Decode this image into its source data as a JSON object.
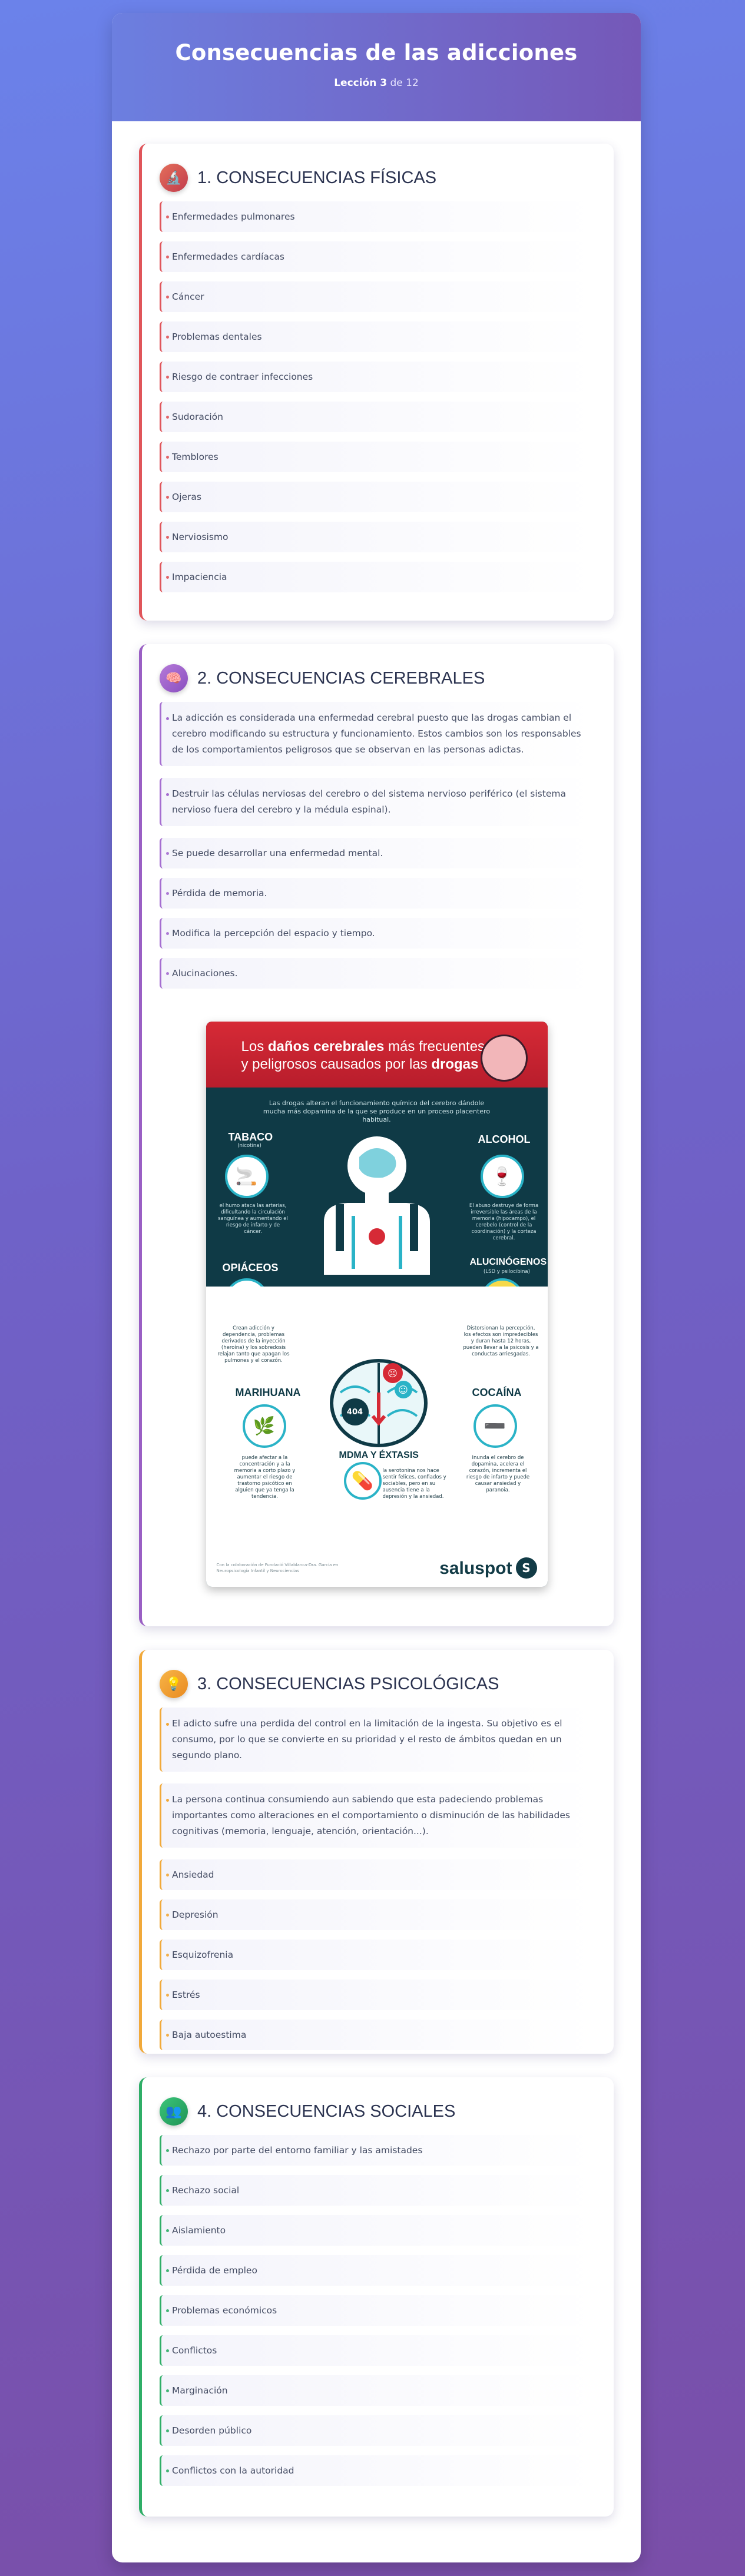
{
  "header": {
    "title": "Consecuencias de las adicciones",
    "lesson_label": "Lección 3",
    "lesson_of": "de 12"
  },
  "sections": [
    {
      "icon": "microscope-icon",
      "title": "1. CONSECUENCIAS FÍSICAS",
      "items": [
        "Enfermedades pulmonares",
        "Enfermedades cardíacas",
        "Cáncer",
        "Problemas dentales",
        "Riesgo de contraer infecciones",
        "Sudoración",
        "Temblores",
        "Ojeras",
        "Nerviosismo",
        "Impaciencia"
      ]
    },
    {
      "icon": "brain-icon",
      "title": "2. CONSECUENCIAS CEREBRALES",
      "paragraphs": [
        "La adicción es considerada una enfermedad cerebral puesto que las drogas cambian el cerebro modificando su estructura y funcionamiento. Estos cambios son los responsables de los comportamientos peligrosos que se observan en las personas adictas.",
        "Destruir las células nerviosas del cerebro o del sistema nervioso periférico (el sistema nervioso fuera del cerebro y la médula espinal)."
      ],
      "items": [
        "Se puede desarrollar una enfermedad mental.",
        "Pérdida de memoria.",
        "Modifica la percepción del espacio y tiempo.",
        "Alucinaciones."
      ]
    },
    {
      "icon": "lightbulb-icon",
      "title": "3. CONSECUENCIAS PSICOLÓGICAS",
      "paragraphs": [
        "El adicto sufre una perdida del control en la limitación de la ingesta. Su objetivo es el consumo, por lo que se convierte en su prioridad y el resto de ámbitos quedan en un segundo plano.",
        "La persona continua consumiendo aun sabiendo que esta padeciendo problemas importantes como alteraciones en el comportamiento o disminución de las habilidades cognitivas (memoria, lenguaje, atención, orientación...)."
      ],
      "items": [
        "Ansiedad",
        "Depresión",
        "Esquizofrenia",
        "Estrés",
        "Baja autoestima"
      ]
    },
    {
      "icon": "people-icon",
      "title": "4. CONSECUENCIAS SOCIALES",
      "items": [
        "Rechazo por parte del entorno familiar y las amistades",
        "Rechazo social",
        "Aislamiento",
        "Pérdida de empleo",
        "Problemas económicos",
        "Conflictos",
        "Marginación",
        "Desorden público",
        "Conflictos con la autoridad"
      ]
    }
  ],
  "infographic": {
    "title_line1_a": "Los",
    "title_line1_b": "daños cerebrales",
    "title_line1_c": "más frecuentes",
    "title_line2_a": "y peligrosos causados por las",
    "title_line2_b": "drogas",
    "subtitle": "Las drogas alteran el funcionamiento químico del cerebro dándole mucha más dopamina de la que se produce en un proceso placentero habitual.",
    "tabaco": "TABACO",
    "tabaco_sub": "(nicotina)",
    "tabaco_text": "el humo ataca las arterias, dificultando la circulación sanguínea y aumentando el riesgo de infarto y de cáncer.",
    "alcohol": "ALCOHOL",
    "alcohol_text": "El abuso destruye de forma irreversible las áreas de la memoria (hipocampo), el cerebelo (control de la coordinación) y la corteza cerebral.",
    "opiaceos": "OPIÁCEOS",
    "opiaceos_text": "Crean adicción y dependencia, problemas derivados de la inyección (heroína) y los sobredosis relajan tanto que apagan los pulmones y el corazón.",
    "alucinogenos": "ALUCINÓGENOS",
    "alucinogenos_sub": "(LSD y psilocibina)",
    "alucinogenos_text": "Distorsionan la percepción, los efectos son impredecibles y duran hasta 12 horas, pueden llevar a la psicosis y a conductas arriesgadas.",
    "marihuana": "MARIHUANA",
    "marihuana_text": "puede afectar a la concentración y a la memoria a corto plazo y aumentar el riesgo de trastorno psicótico en alguien que ya tenga la tendencia.",
    "cocaina": "COCAÍNA",
    "cocaina_text": "Inunda el cerebro de dopamina, acelera el corazón, incrementa el riesgo de infarto y puede causar ansiedad y paranoia.",
    "mdma": "MDMA Y ÉXTASIS",
    "mdma_text": "la serotonina nos hace sentir felices, confiados y sociables, pero en su ausencia tiene a la depresión y la ansiedad.",
    "brain_404": "404",
    "credit": "Con la colaboración de Fundació Villablanca-Dra. García en Neuropsicología Infantil y Neurociencias",
    "brand": "saluspot",
    "brand_logo": "S"
  }
}
